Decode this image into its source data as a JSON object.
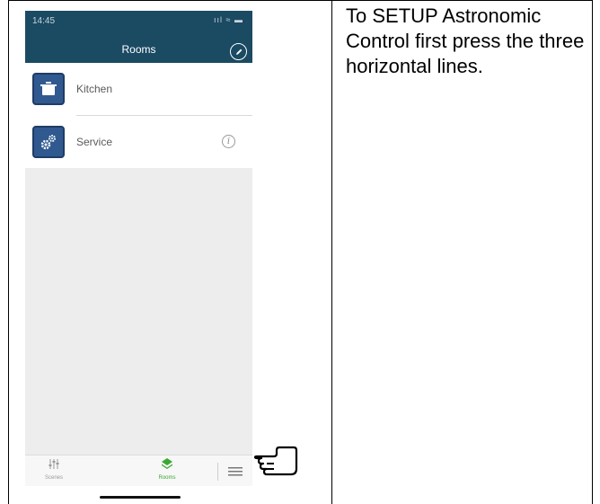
{
  "status_bar": {
    "time": "14:45",
    "icons": "ııl ≈ ▬"
  },
  "header": {
    "title": "Rooms"
  },
  "rooms": [
    {
      "label": "Kitchen",
      "icon": "kitchen-pot-icon"
    },
    {
      "label": "Service",
      "icon": "gears-icon"
    }
  ],
  "info_icon_glyph": "i",
  "tabbar": {
    "scenes_label": "Scenes",
    "rooms_label": "Rooms",
    "active_color": "#3aa832",
    "inactive_color": "#9a9a9a"
  },
  "colors": {
    "header": "#1b4a63",
    "room_icon_bg": "#30598f"
  },
  "instruction_text": "To SETUP Astronomic Control first press the three horizontal lines."
}
